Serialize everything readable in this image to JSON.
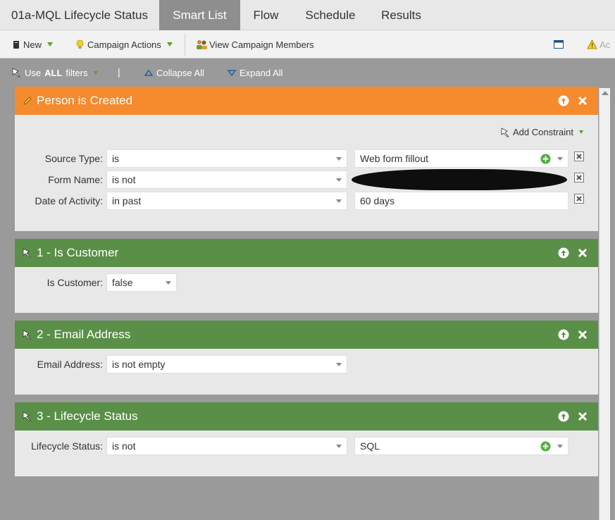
{
  "tabs": [
    {
      "label": "01a-MQL Lifecycle Status"
    },
    {
      "label": "Smart List"
    },
    {
      "label": "Flow"
    },
    {
      "label": "Schedule"
    },
    {
      "label": "Results"
    }
  ],
  "toolbar": {
    "new_label": "New",
    "campaign_actions_label": "Campaign Actions",
    "view_members_label": "View Campaign Members",
    "truncated_label": "Ac"
  },
  "options": {
    "use_prefix": "Use",
    "use_bold": "ALL",
    "use_suffix": "filters",
    "separator": "|",
    "collapse_label": "Collapse All",
    "expand_label": "Expand All"
  },
  "filters": [
    {
      "title": "Person is Created",
      "color": "#f58a2e",
      "add_constraint": "Add Constraint",
      "rows": [
        {
          "label": "Source Type:",
          "operator": "is",
          "value": "Web form fillout"
        },
        {
          "label": "Form Name:",
          "operator": "is not",
          "value": ""
        },
        {
          "label": "Date of Activity:",
          "operator": "in past",
          "value": "60 days"
        }
      ]
    },
    {
      "title": "1 - Is Customer",
      "color": "#5a8f48",
      "rows": [
        {
          "label": "Is Customer:",
          "operator": "false"
        }
      ]
    },
    {
      "title": "2 - Email Address",
      "color": "#5a8f48",
      "rows": [
        {
          "label": "Email Address:",
          "operator": "is not empty"
        }
      ]
    },
    {
      "title": "3 - Lifecycle Status",
      "color": "#5a8f48",
      "rows": [
        {
          "label": "Lifecycle Status:",
          "operator": "is not",
          "value": "SQL"
        }
      ]
    }
  ]
}
